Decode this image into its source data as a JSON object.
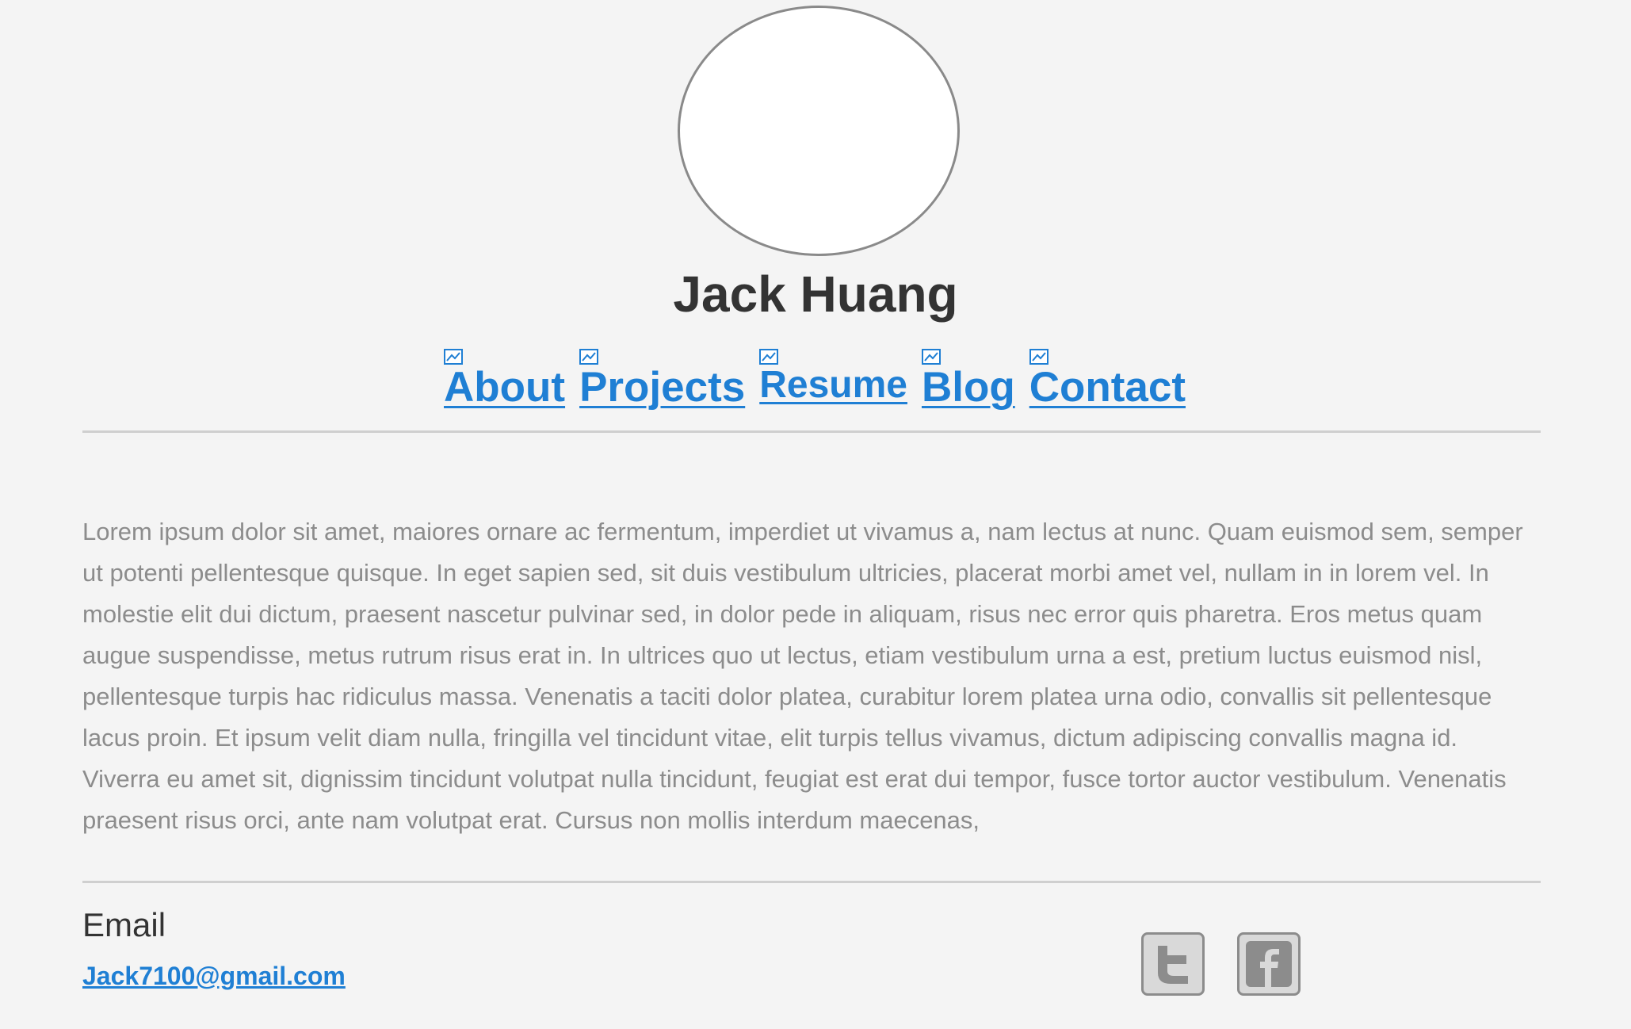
{
  "profile": {
    "name": "Jack Huang"
  },
  "nav": {
    "items": [
      {
        "label": "About"
      },
      {
        "label": "Projects"
      },
      {
        "label": "Resume"
      },
      {
        "label": "Blog"
      },
      {
        "label": "Contact"
      }
    ]
  },
  "about": {
    "text": "Lorem ipsum dolor sit amet, maiores ornare ac fermentum, imperdiet ut vivamus a, nam lectus at nunc. Quam euismod sem, semper ut potenti pellentesque quisque. In eget sapien sed, sit duis vestibulum ultricies, placerat morbi amet vel, nullam in in lorem vel. In molestie elit dui dictum, praesent nascetur pulvinar sed, in dolor pede in aliquam, risus nec error quis pharetra. Eros metus quam augue suspendisse, metus rutrum risus erat in.  In ultrices quo ut lectus, etiam vestibulum urna a est, pretium luctus euismod nisl, pellentesque turpis hac ridiculus massa. Venenatis a taciti dolor platea, curabitur lorem platea urna odio, convallis sit pellentesque lacus proin. Et ipsum velit diam nulla, fringilla vel tincidunt vitae, elit turpis tellus vivamus, dictum adipiscing convallis magna id. Viverra eu amet sit, dignissim tincidunt volutpat nulla tincidunt, feugiat est erat dui tempor, fusce tortor auctor vestibulum. Venenatis praesent risus orci, ante nam volutpat erat. Cursus non mollis interdum maecenas,"
  },
  "contact": {
    "heading": "Email",
    "email": "Jack7100@gmail.com"
  },
  "social": {
    "icons": [
      "twitter-icon",
      "facebook-icon"
    ]
  },
  "colors": {
    "background": "#f4f4f4",
    "link": "#1f7fd4",
    "heading": "#333333",
    "body_text": "#8c8c8c",
    "rule": "#cfcfcf"
  }
}
